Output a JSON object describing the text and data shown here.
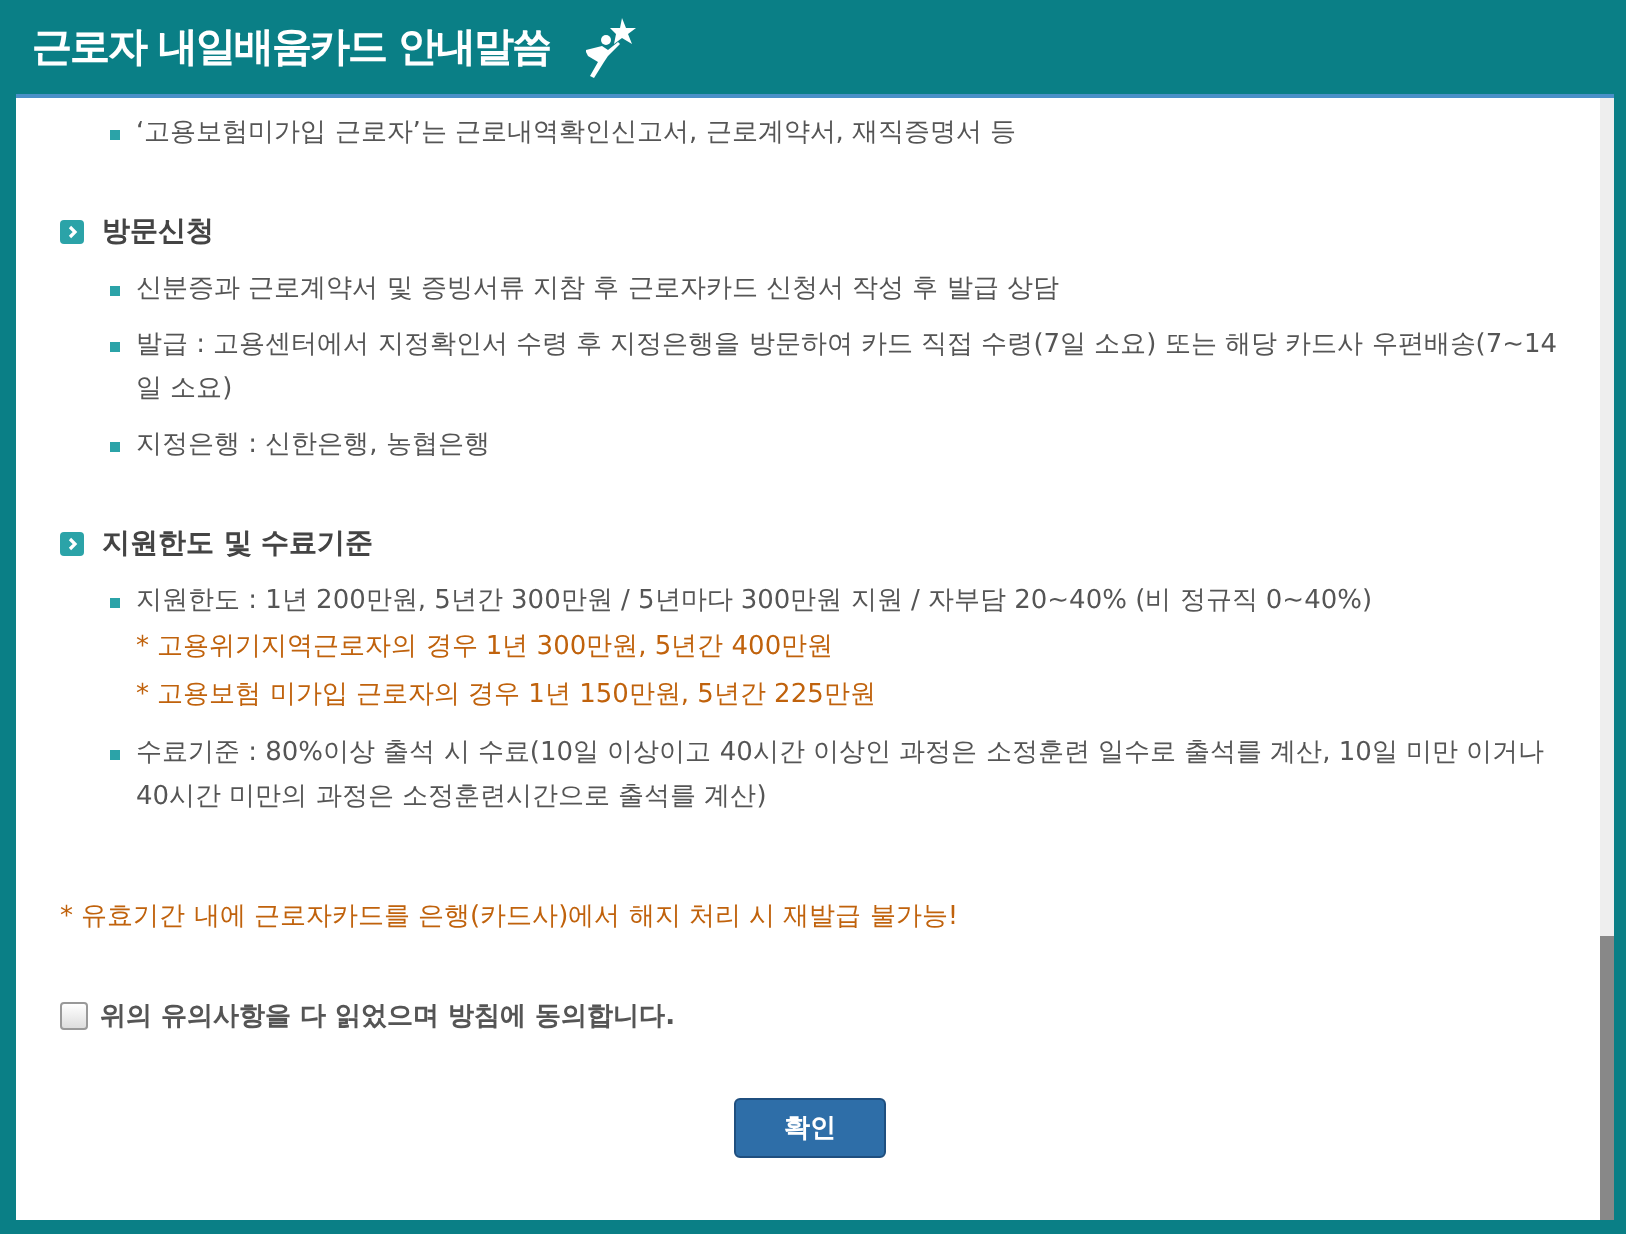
{
  "window": {
    "title": "근로자 내일배움카드 안내말씀"
  },
  "intro_items": [
    "‘고용보험미가입 근로자’는 근로내역확인신고서, 근로계약서, 재직증명서 등"
  ],
  "sections": [
    {
      "heading": "방문신청",
      "items": [
        {
          "text": "신분증과 근로계약서 및 증빙서류 지참 후 근로자카드 신청서 작성 후 발급 상담"
        },
        {
          "text": "발급 : 고용센터에서 지정확인서 수령 후 지정은행을 방문하여 카드 직접 수령(7일 소요) 또는 해당 카드사 우편배송(7~14일 소요)"
        },
        {
          "text": "지정은행 : 신한은행, 농협은행"
        }
      ]
    },
    {
      "heading": "지원한도 및 수료기준",
      "items": [
        {
          "text": "지원한도 : 1년 200만원, 5년간 300만원 / 5년마다 300만원 지원 / 자부담 20~40% (비 정규직 0~40%)",
          "notes": [
            "* 고용위기지역근로자의 경우 1년 300만원, 5년간 400만원",
            "* 고용보험 미가입 근로자의 경우 1년 150만원, 5년간 225만원"
          ]
        },
        {
          "text": "수료기준 : 80%이상 출석 시 수료(10일 이상이고 40시간 이상인 과정은 소정훈련 일수로 출석를 계산, 10일 미만 이거나 40시간 미만의 과정은 소정훈련시간으로 출석를 계산)"
        }
      ]
    }
  ],
  "warning": "* 유효기간 내에 근로자카드를 은행(카드사)에서 해지 처리 시 재발급 불가능!",
  "agreement": {
    "label": "위의 유의사항을 다 읽었으며 방침에 동의합니다.",
    "checked": false
  },
  "button": "확인"
}
